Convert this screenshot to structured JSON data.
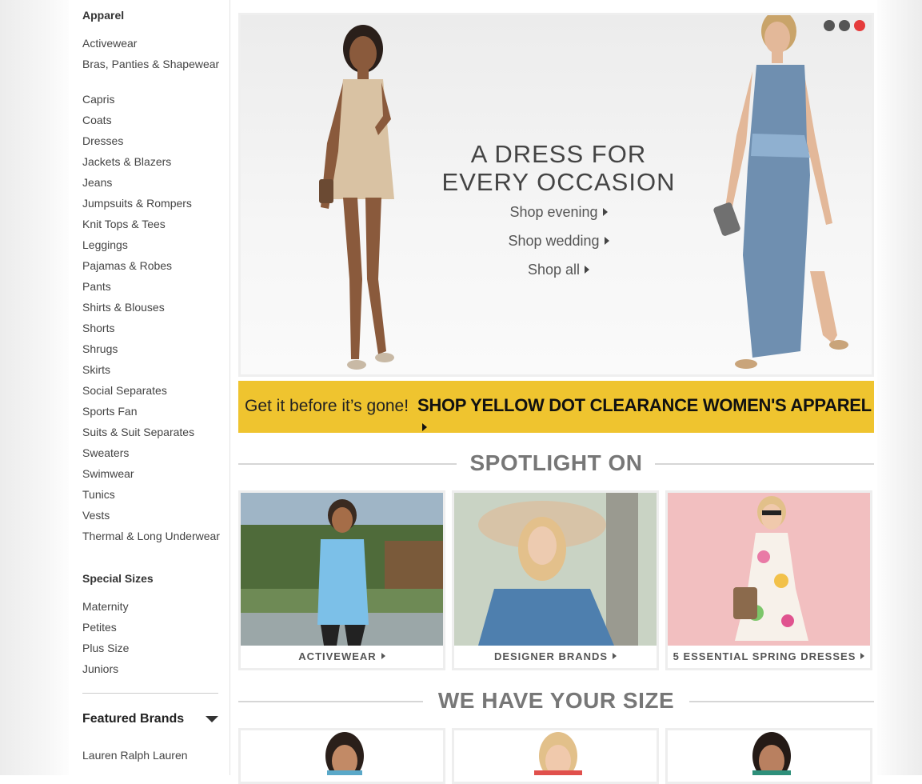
{
  "sidebar": {
    "apparel_heading": "Apparel",
    "apparel_items": [
      {
        "label": "Activewear"
      },
      {
        "label": "Bras, Panties & Shapewear"
      },
      {
        "label": "Capris"
      },
      {
        "label": "Coats"
      },
      {
        "label": "Dresses"
      },
      {
        "label": "Jackets & Blazers"
      },
      {
        "label": "Jeans"
      },
      {
        "label": "Jumpsuits & Rompers"
      },
      {
        "label": "Knit Tops & Tees"
      },
      {
        "label": "Leggings"
      },
      {
        "label": "Pajamas & Robes"
      },
      {
        "label": "Pants"
      },
      {
        "label": "Shirts & Blouses"
      },
      {
        "label": "Shorts"
      },
      {
        "label": "Shrugs"
      },
      {
        "label": "Skirts"
      },
      {
        "label": "Social Separates"
      },
      {
        "label": "Sports Fan"
      },
      {
        "label": "Suits & Suit Separates"
      },
      {
        "label": "Sweaters"
      },
      {
        "label": "Swimwear"
      },
      {
        "label": "Tunics"
      },
      {
        "label": "Vests"
      },
      {
        "label": "Thermal & Long Underwear"
      }
    ],
    "special_heading": "Special Sizes",
    "special_items": [
      {
        "label": "Maternity"
      },
      {
        "label": "Petites"
      },
      {
        "label": "Plus Size"
      },
      {
        "label": "Juniors"
      }
    ],
    "featured_label": "Featured Brands",
    "featured_first": "Lauren Ralph Lauren"
  },
  "hero": {
    "title_line1": "A DRESS FOR",
    "title_line2": "EVERY OCCASION",
    "links": [
      "Shop evening",
      "Shop wedding",
      "Shop all"
    ],
    "slide_count": 3,
    "active_slide": 3
  },
  "banner": {
    "pre": "Get it before it’s gone!",
    "cta": "SHOP YELLOW DOT CLEARANCE WOMEN'S APPAREL"
  },
  "spotlight": {
    "title": "SPOTLIGHT ON",
    "cards": [
      {
        "label": "ACTIVEWEAR"
      },
      {
        "label": "DESIGNER BRANDS"
      },
      {
        "label": "5 ESSENTIAL SPRING DRESSES"
      }
    ]
  },
  "sizes": {
    "title": "WE HAVE YOUR SIZE"
  },
  "colors": {
    "banner_yellow": "#efc42f",
    "active_dot": "#e53b3b",
    "heading_gray": "#777777"
  }
}
